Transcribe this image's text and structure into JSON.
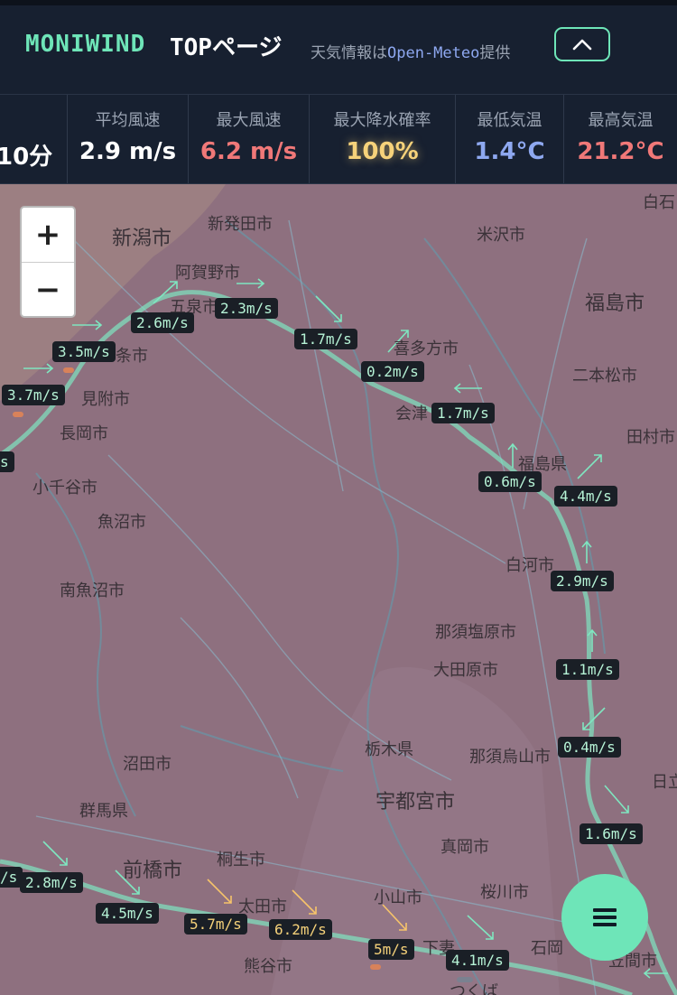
{
  "header": {
    "brand": "MONIWIND",
    "top_link": "TOPページ",
    "credit_prefix": "天気情報は",
    "credit_source": "Open-Meteo",
    "credit_suffix": "提供"
  },
  "stats": [
    {
      "label": "",
      "value": "10分",
      "color": "#ffffff"
    },
    {
      "label": "平均風速",
      "value": "2.9 m/s",
      "color": "#ffffff"
    },
    {
      "label": "最大風速",
      "value": "6.2 m/s",
      "color": "#f07878"
    },
    {
      "label": "最大降水確率",
      "value": "100%",
      "color": "#f6d27a"
    },
    {
      "label": "最低気温",
      "value": "1.4°C",
      "color": "#8ea8f0"
    },
    {
      "label": "最高気温",
      "value": "21.2°C",
      "color": "#f07878"
    }
  ],
  "map": {
    "places": [
      {
        "text": "新潟市",
        "big": true
      },
      {
        "text": "新発田市"
      },
      {
        "text": "米沢市"
      },
      {
        "text": "白石"
      },
      {
        "text": "阿賀野市"
      },
      {
        "text": "五泉市"
      },
      {
        "text": "福島市",
        "big": true
      },
      {
        "text": "喜多方市"
      },
      {
        "text": "二本松市"
      },
      {
        "text": "三条市"
      },
      {
        "text": "見附市"
      },
      {
        "text": "会津"
      },
      {
        "text": "長岡市"
      },
      {
        "text": "田村市"
      },
      {
        "text": "福島県"
      },
      {
        "text": "小千谷市"
      },
      {
        "text": "魚沼市"
      },
      {
        "text": "白河市"
      },
      {
        "text": "南魚沼市"
      },
      {
        "text": "那須塩原市"
      },
      {
        "text": "大田原市"
      },
      {
        "text": "沼田市"
      },
      {
        "text": "栃木県"
      },
      {
        "text": "那須烏山市"
      },
      {
        "text": "群馬県"
      },
      {
        "text": "宇都宮市",
        "big": true
      },
      {
        "text": "日立"
      },
      {
        "text": "真岡市"
      },
      {
        "text": "前橋市",
        "big": true
      },
      {
        "text": "桐生市"
      },
      {
        "text": "太田市"
      },
      {
        "text": "桜川市"
      },
      {
        "text": "小山市"
      },
      {
        "text": "石岡"
      },
      {
        "text": "熊谷市"
      },
      {
        "text": "下妻"
      },
      {
        "text": "つくば"
      },
      {
        "text": "笠間市"
      }
    ],
    "wind_labels": [
      {
        "text": "2.6m/s"
      },
      {
        "text": "2.3m/s"
      },
      {
        "text": "1.7m/s"
      },
      {
        "text": "3.5m/s"
      },
      {
        "text": "0.2m/s"
      },
      {
        "text": "3.7m/s"
      },
      {
        "text": "1.7m/s"
      },
      {
        "text": "s"
      },
      {
        "text": "0.6m/s"
      },
      {
        "text": "4.4m/s"
      },
      {
        "text": "2.9m/s"
      },
      {
        "text": "1.1m/s"
      },
      {
        "text": "0.4m/s"
      },
      {
        "text": "1.6m/s"
      },
      {
        "text": "/s"
      },
      {
        "text": "2.8m/s"
      },
      {
        "text": "4.5m/s",
        "hot": false
      },
      {
        "text": "5.7m/s",
        "hot": true
      },
      {
        "text": "6.2m/s",
        "hot": true
      },
      {
        "text": "5m/s",
        "hot": true
      },
      {
        "text": "4.1m/s"
      }
    ],
    "zoom_in": "+",
    "zoom_out": "−"
  }
}
